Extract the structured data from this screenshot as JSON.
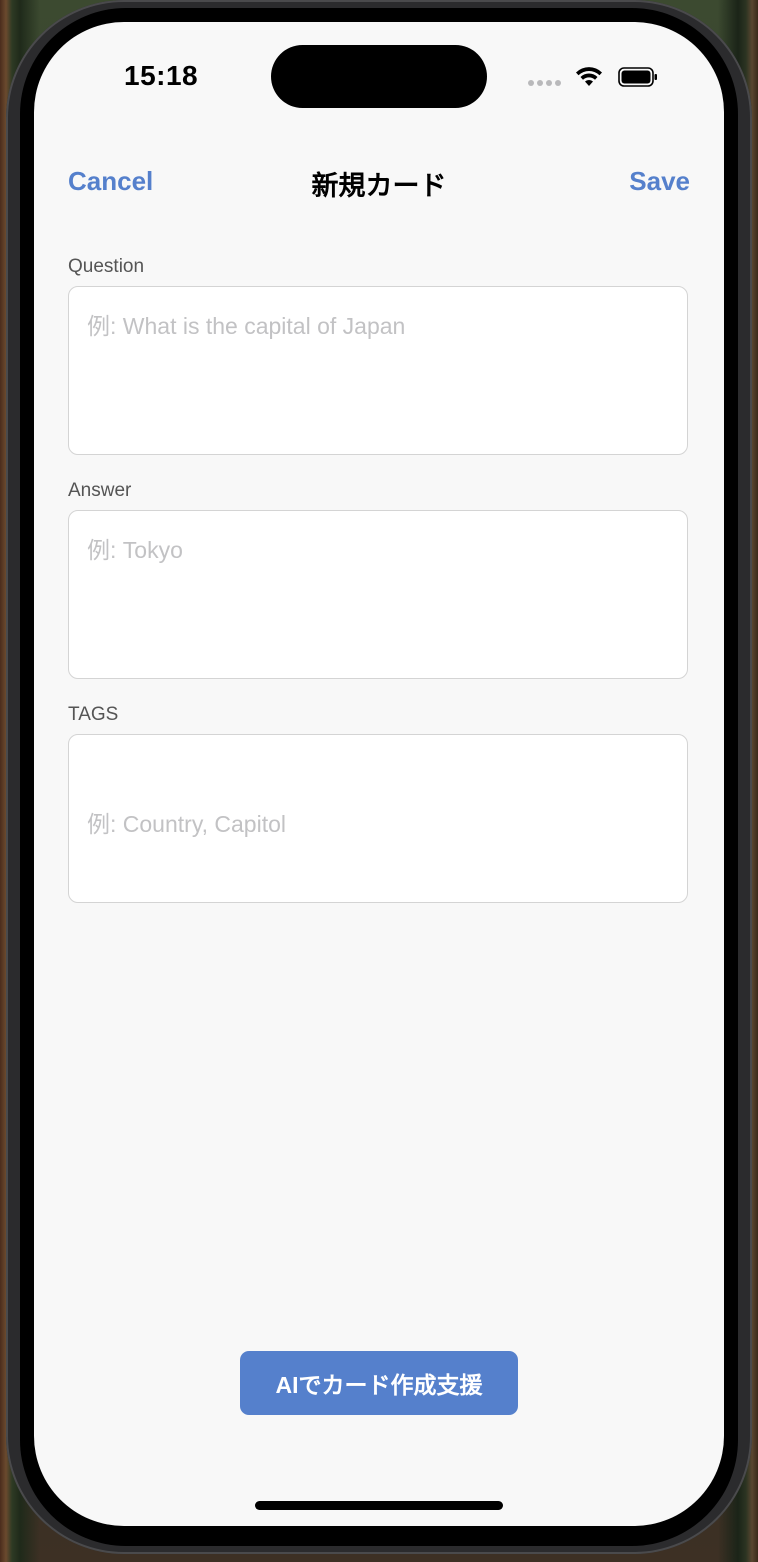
{
  "status_bar": {
    "time": "15:18",
    "icons": [
      "cellular-dots-icon",
      "wifi-icon",
      "battery-icon"
    ]
  },
  "nav": {
    "cancel_label": "Cancel",
    "title": "新規カード",
    "save_label": "Save"
  },
  "form": {
    "question": {
      "label": "Question",
      "value": "",
      "placeholder": "例: What is the capital of Japan"
    },
    "answer": {
      "label": "Answer",
      "value": "",
      "placeholder": "例: Tokyo"
    },
    "tags": {
      "label": "TAGS",
      "value": "",
      "placeholder": "例: Country, Capitol"
    }
  },
  "ai_button": {
    "label": "AIでカード作成支援"
  },
  "colors": {
    "accent": "#5580cc",
    "background": "#f8f8f8",
    "field_border": "#d4d4d4",
    "placeholder": "#c2c2c4"
  }
}
